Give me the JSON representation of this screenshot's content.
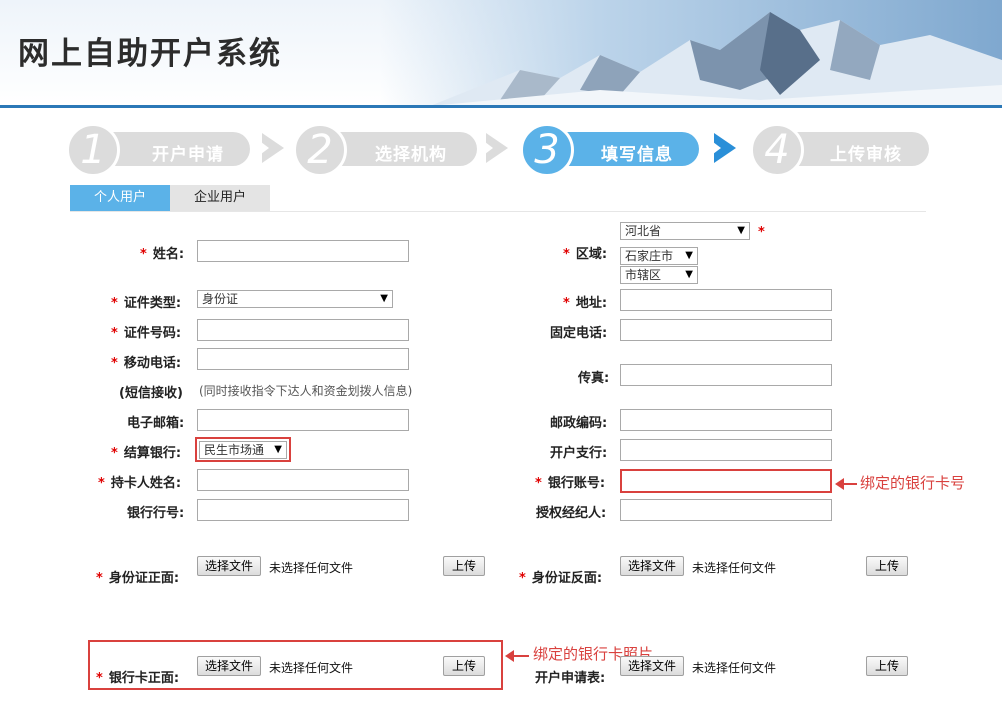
{
  "header": {
    "title": "网上自助开户系统"
  },
  "steps": [
    {
      "num": "1",
      "label": "开户申请",
      "active": false
    },
    {
      "num": "2",
      "label": "选择机构",
      "active": false
    },
    {
      "num": "3",
      "label": "填写信息",
      "active": true
    },
    {
      "num": "4",
      "label": "上传审核",
      "active": false
    }
  ],
  "tabs": {
    "personal": "个人用户",
    "enterprise": "企业用户"
  },
  "form": {
    "required_mark": "*",
    "name_label": "姓名:",
    "id_type_label": "证件类型:",
    "id_type_value": "身份证",
    "id_number_label": "证件号码:",
    "mobile_label": "移动电话:",
    "sms_label": "(短信接收)",
    "sms_note": "(同时接收指令下达人和资金划拨人信息)",
    "email_label": "电子邮箱:",
    "settle_bank_label": "结算银行:",
    "settle_bank_value": "民生市场通",
    "cardholder_label": "持卡人姓名:",
    "bank_code_label": "银行行号:",
    "region_label": "区域:",
    "province": "河北省",
    "city": "石家庄市",
    "district": "市辖区",
    "address_label": "地址:",
    "landline_label": "固定电话:",
    "fax_label": "传真:",
    "postcode_label": "邮政编码:",
    "branch_label": "开户支行:",
    "account_label": "银行账号:",
    "agent_label": "授权经纪人:",
    "id_front_label": "身份证正面:",
    "id_back_label": "身份证反面:",
    "card_front_label": "银行卡正面:",
    "application_label": "开户申请表:",
    "choose_file": "选择文件",
    "no_file": "未选择任何文件",
    "upload": "上传"
  },
  "annotations": {
    "account": "绑定的银行卡号",
    "card_photo": "绑定的银行卡照片"
  },
  "colors": {
    "accent": "#5bb2e8",
    "inactive_step": "#dcdcdc",
    "required": "#e00000",
    "annotation": "#d9413e",
    "header_line": "#2b78b7"
  }
}
